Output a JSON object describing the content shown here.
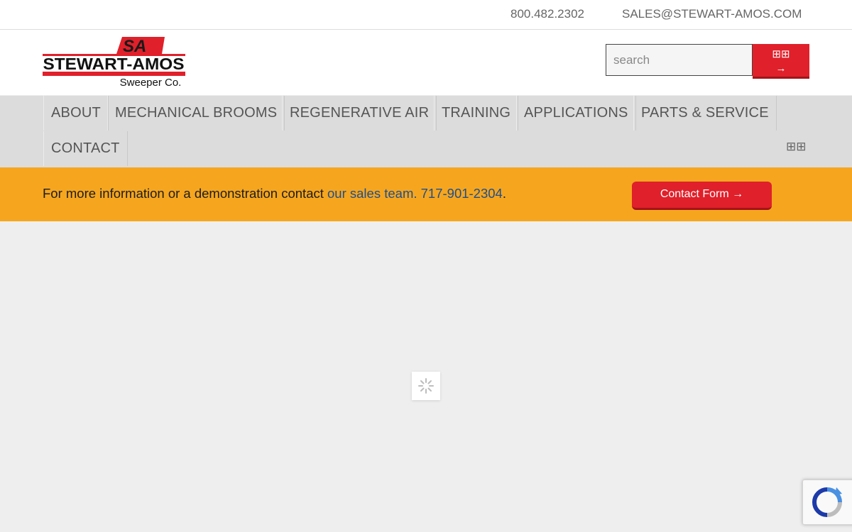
{
  "topbar": {
    "phone": "800.482.2302",
    "email": "SALES@STEWART-AMOS.COM"
  },
  "logo": {
    "monogram": "SA",
    "name": "STEWART-AMOS",
    "tagline": "Sweeper Co."
  },
  "search": {
    "placeholder": "search",
    "button_glyph": "⊞⊞",
    "button_arrow": "→"
  },
  "nav": {
    "items": [
      "ABOUT",
      "MECHANICAL BROOMS",
      "REGENERATIVE AIR",
      "TRAINING",
      "APPLICATIONS",
      "PARTS & SERVICE",
      "CONTACT"
    ],
    "menu_glyph": "⊞⊞"
  },
  "banner": {
    "text_before": "For more information or a demonstration contact ",
    "link_text": "our sales team. 717-901-2304",
    "text_after": ".",
    "button_label": "Contact Form →"
  },
  "colors": {
    "brand_red": "#e0202a",
    "banner_orange": "#f6a61e",
    "nav_gray": "#dcdcdc",
    "link_blue": "#1f4e8c"
  }
}
